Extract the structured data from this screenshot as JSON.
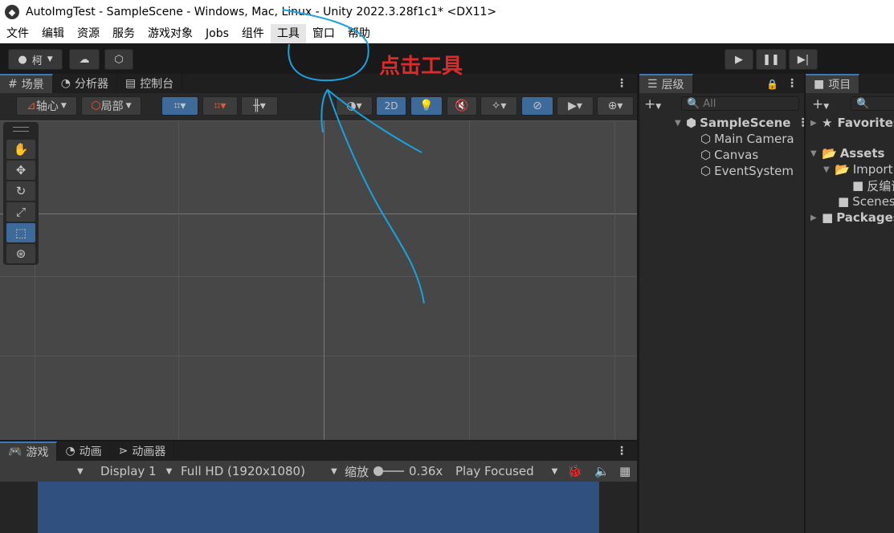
{
  "window": {
    "title": "AutoImgTest - SampleScene - Windows, Mac, Linux - Unity 2022.3.28f1c1* <DX11>"
  },
  "menu": [
    "文件",
    "编辑",
    "资源",
    "服务",
    "游戏对象",
    "Jobs",
    "组件",
    "工具",
    "窗口",
    "帮助"
  ],
  "toolbar": {
    "account": "柯"
  },
  "annotation": {
    "text": "点击工具",
    "color": "#e02a2a",
    "stroke": "#1aa1e0"
  },
  "scene_tabs": [
    "场景",
    "分析器",
    "控制台"
  ],
  "scene_toolbar": {
    "pivot": "轴心",
    "local": "局部",
    "mode_2d": "2D"
  },
  "hierarchy": {
    "tab": "层级",
    "search_placeholder": "All",
    "scene": "SampleScene",
    "items": [
      "Main Camera",
      "Canvas",
      "EventSystem"
    ]
  },
  "project": {
    "tab": "项目",
    "favorites": "Favorites",
    "assets": "Assets",
    "import": "Import",
    "decompile": "反编译",
    "scenes": "Scenes",
    "packages": "Packages"
  },
  "game_tabs": [
    "游戏",
    "动画",
    "动画器"
  ],
  "game_bar": {
    "display": "Display 1",
    "resolution": "Full HD (1920x1080)",
    "scale_label": "缩放",
    "scale_value": "0.36x",
    "play_mode": "Play Focused"
  },
  "colors": {
    "game_view": "#30507f",
    "accent": "#3d6a9b"
  }
}
